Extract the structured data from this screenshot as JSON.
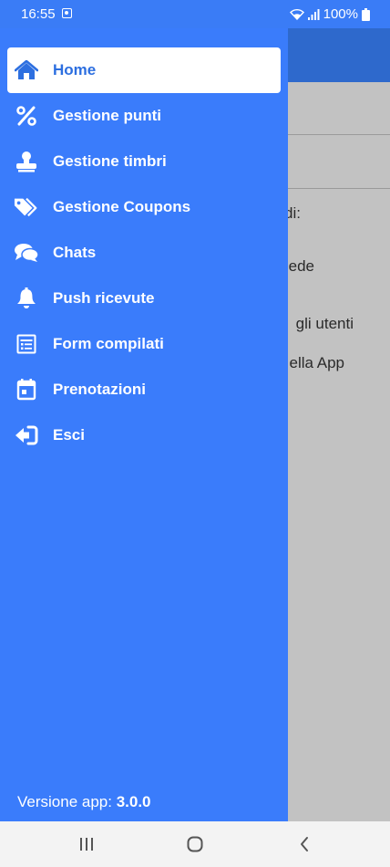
{
  "status_bar": {
    "time": "16:55",
    "battery": "100%"
  },
  "background": {
    "lines": [
      "di:",
      "ede",
      "gli utenti",
      "ella App"
    ]
  },
  "drawer": {
    "accent_color": "#3a7cfb",
    "active_text_color": "#2d6fe0",
    "items": [
      {
        "label": "Home",
        "icon": "home-icon",
        "active": true
      },
      {
        "label": "Gestione punti",
        "icon": "percent-icon"
      },
      {
        "label": "Gestione timbri",
        "icon": "stamp-icon"
      },
      {
        "label": "Gestione Coupons",
        "icon": "tags-icon"
      },
      {
        "label": "Chats",
        "icon": "chat-bubbles-icon"
      },
      {
        "label": "Push ricevute",
        "icon": "bell-icon"
      },
      {
        "label": "Form compilati",
        "icon": "form-icon"
      },
      {
        "label": "Prenotazioni",
        "icon": "calendar-icon"
      },
      {
        "label": "Esci",
        "icon": "sign-out-icon"
      }
    ],
    "version_label": "Versione app:",
    "version_value": "3.0.0"
  },
  "navbar": {
    "recent": "recent-apps-icon",
    "home": "home-circle-icon",
    "back": "back-icon"
  }
}
